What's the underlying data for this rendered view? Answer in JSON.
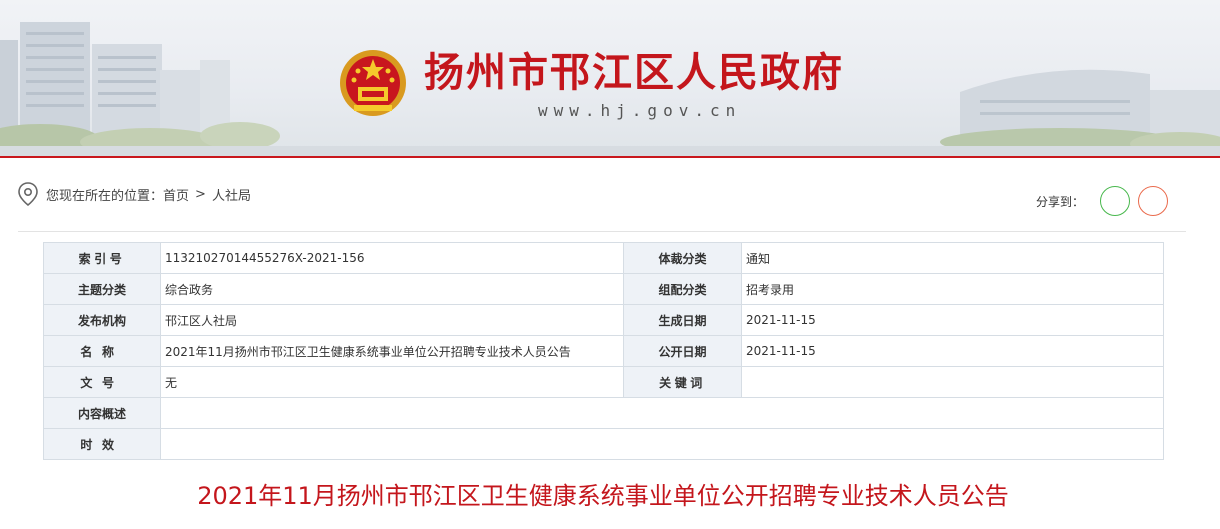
{
  "site": {
    "title": "扬州市邗江区人民政府",
    "url": "www.hj.gov.cn"
  },
  "breadcrumb": {
    "prefix": "您现在所在的位置：",
    "items": [
      "首页",
      "人社局"
    ],
    "separator": ">"
  },
  "share": {
    "label": "分享到：",
    "buttons": [
      "wechat-icon",
      "weibo-icon"
    ]
  },
  "meta": {
    "index_no": {
      "label": "索引号",
      "value": "11321027014455276X-2021-156"
    },
    "genre": {
      "label": "体裁分类",
      "value": "通知"
    },
    "topic": {
      "label": "主题分类",
      "value": "综合政务"
    },
    "category": {
      "label": "组配分类",
      "value": "招考录用"
    },
    "publisher": {
      "label": "发布机构",
      "value": "邗江区人社局"
    },
    "created": {
      "label": "生成日期",
      "value": "2021-11-15"
    },
    "name": {
      "label": "名称",
      "value": "2021年11月扬州市邗江区卫生健康系统事业单位公开招聘专业技术人员公告"
    },
    "published": {
      "label": "公开日期",
      "value": "2021-11-15"
    },
    "doc_no": {
      "label": "文号",
      "value": "无"
    },
    "keywords": {
      "label": "关键词",
      "value": ""
    },
    "summary": {
      "label": "内容概述",
      "value": ""
    },
    "validity": {
      "label": "时效",
      "value": ""
    }
  },
  "article": {
    "title": "2021年11月扬州市邗江区卫生健康系统事业单位公开招聘专业技术人员公告"
  },
  "colors": {
    "brand_red": "#c4161c",
    "table_key_bg": "#eef2f7",
    "table_border": "#d6dde4"
  }
}
